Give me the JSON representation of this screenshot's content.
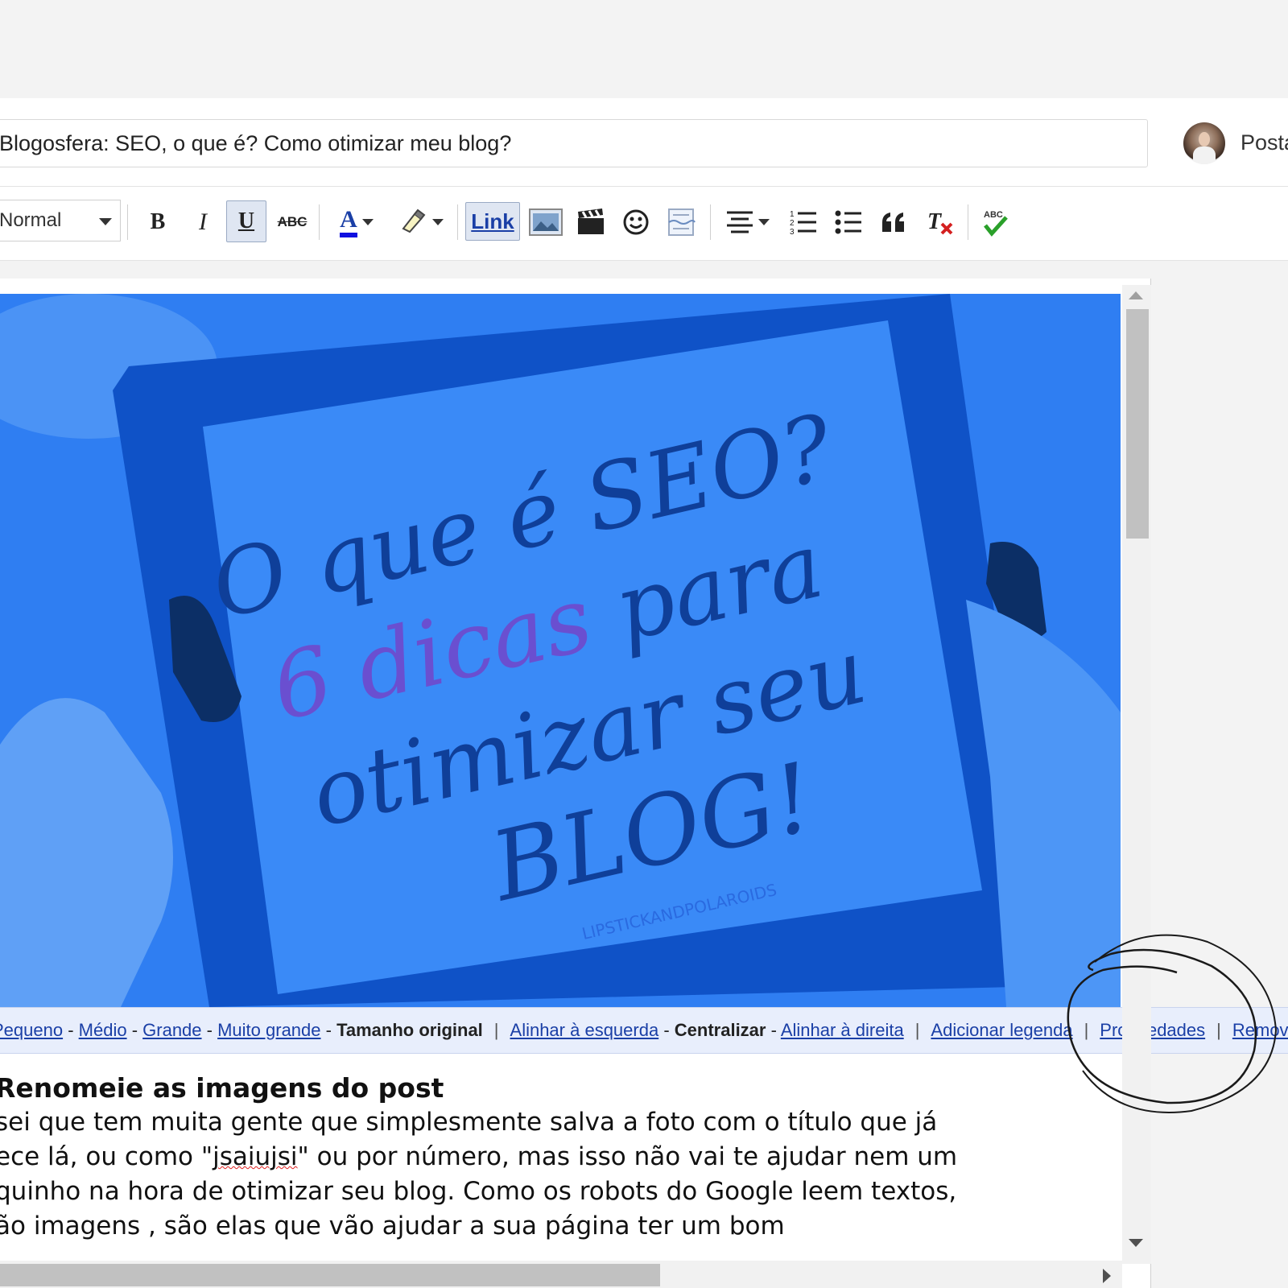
{
  "header": {
    "title_value": "Blogosfera: SEO, o que é? Como otimizar meu blog?",
    "post_button": "Postar"
  },
  "toolbar": {
    "format_value": "Normal",
    "bold": "B",
    "italic": "I",
    "underline": "U",
    "strike": "ABC",
    "font_color": "A",
    "link": "Link",
    "spell": "ABC"
  },
  "image": {
    "line1": "O que é SEO?",
    "line2_number": "6 dicas",
    "line2_rest": " para",
    "line3": "otimizar seu",
    "line4": "BLOG!",
    "watermark": "LIPSTICKANDPOLAROIDS",
    "overlay_color": "#2f7ef2"
  },
  "image_bar": {
    "small": "Pequeno",
    "medium": "Médio",
    "large": "Grande",
    "xlarge": "Muito grande",
    "original": "Tamanho original",
    "align_left": "Alinhar à esquerda",
    "center": "Centralizar",
    "align_right": "Alinhar à direita",
    "caption": "Adicionar legenda",
    "properties": "Propriedades",
    "remove": "Remover"
  },
  "body": {
    "heading": "Renomeie as imagens do post",
    "line1": "sei que tem muita gente que simplesmente salva a foto com o título que já",
    "line2_pre": "ece lá, ou como \"",
    "line2_word": "jsaiujsi",
    "line2_post": "\" ou por número, mas isso não vai te ajudar nem um",
    "line3": "quinho na hora de otimizar seu blog. Como os robots do Google leem textos,",
    "line4": "ão imagens , são elas que vão ajudar a sua página ter um bom"
  },
  "colors": {
    "link": "#1a3fa6",
    "image_overlay": "#2f7ef2",
    "annotation": "#1a1a1a"
  }
}
